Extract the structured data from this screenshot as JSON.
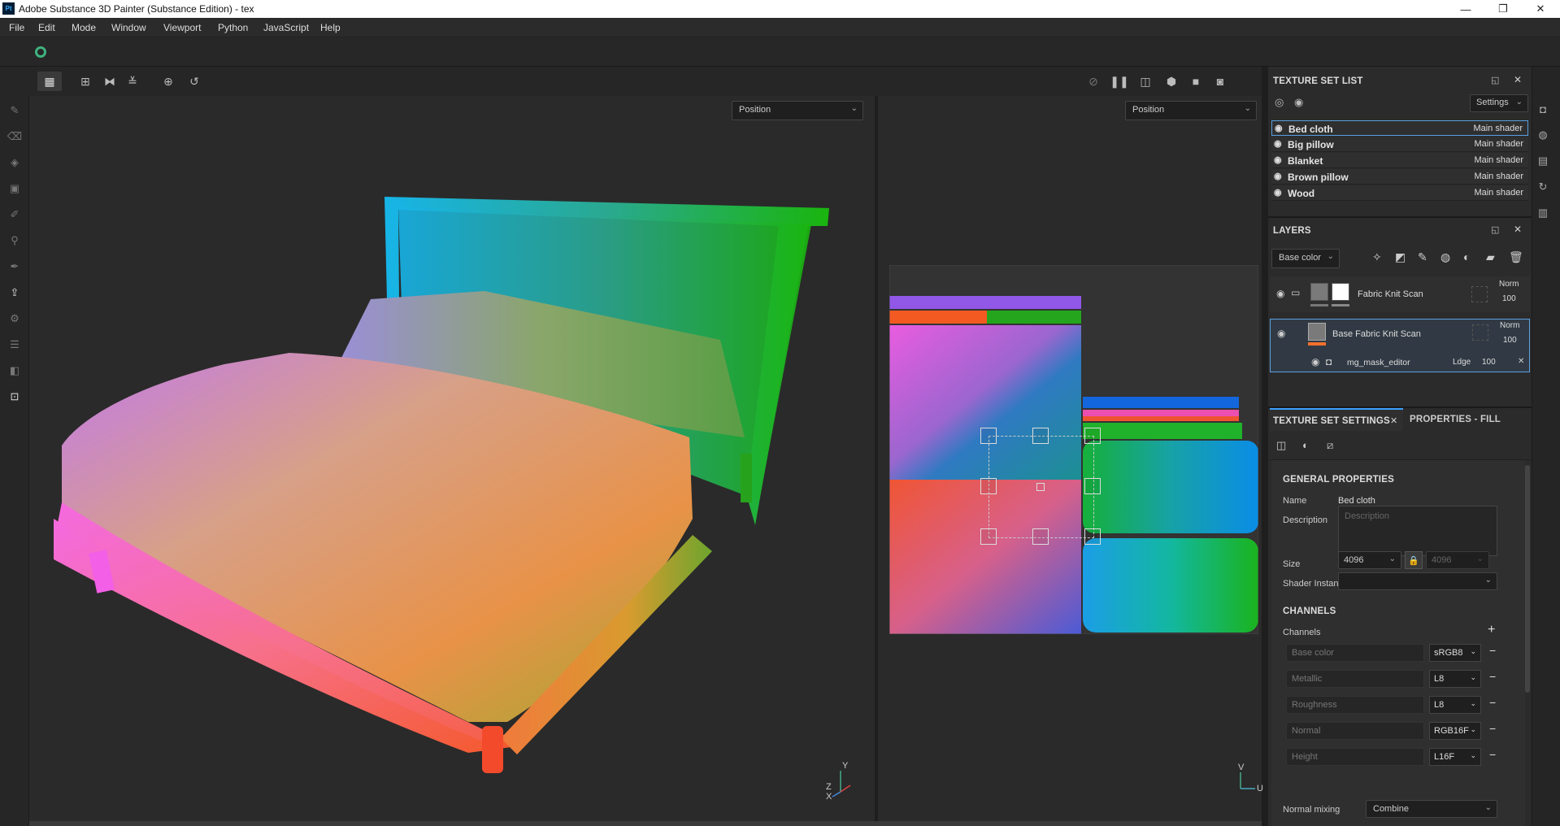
{
  "window": {
    "title": "Adobe Substance 3D Painter (Substance Edition) - tex",
    "app_icon": "Pt",
    "controls": {
      "minimize": "—",
      "maximize": "❐",
      "close": "✕"
    }
  },
  "menu": [
    "File",
    "Edit",
    "Mode",
    "Window",
    "Viewport",
    "Python",
    "JavaScript",
    "Help"
  ],
  "viewport": {
    "left_dropdown": "Position",
    "right_dropdown": "Position",
    "axis_3d": {
      "y": "Y",
      "z": "Z",
      "x": "X"
    },
    "axis_2d": {
      "v": "V",
      "u": "U"
    }
  },
  "texture_set_list": {
    "title": "TEXTURE SET LIST",
    "settings_label": "Settings",
    "items": [
      {
        "name": "Bed cloth",
        "shader": "Main shader",
        "selected": true
      },
      {
        "name": "Big pillow",
        "shader": "Main shader"
      },
      {
        "name": "Blanket",
        "shader": "Main shader"
      },
      {
        "name": "Brown pillow",
        "shader": "Main shader"
      },
      {
        "name": "Wood",
        "shader": "Main shader"
      }
    ]
  },
  "layers": {
    "title": "LAYERS",
    "channel_dropdown": "Base color",
    "items": [
      {
        "name": "Fabric Knit Scan",
        "blend": "Norm",
        "opacity": "100"
      },
      {
        "name": "Base Fabric Knit Scan",
        "blend": "Norm",
        "opacity": "100"
      }
    ],
    "mask": {
      "name": "mg_mask_editor",
      "blend": "Ldge",
      "opacity": "100"
    }
  },
  "tabs": {
    "active": "TEXTURE SET SETTINGS",
    "other": "PROPERTIES - FILL"
  },
  "general": {
    "heading": "GENERAL PROPERTIES",
    "name_label": "Name",
    "name_value": "Bed cloth",
    "description_label": "Description",
    "description_placeholder": "Description",
    "size_label": "Size",
    "size_value": "4096",
    "size_linked": "4096",
    "shader_label": "Shader Instance",
    "shader_value": ""
  },
  "channels": {
    "heading": "CHANNELS",
    "label": "Channels",
    "add": "+",
    "items": [
      {
        "name": "Base color",
        "format": "sRGB8"
      },
      {
        "name": "Metallic",
        "format": "L8"
      },
      {
        "name": "Roughness",
        "format": "L8"
      },
      {
        "name": "Normal",
        "format": "RGB16F"
      },
      {
        "name": "Height",
        "format": "L16F"
      }
    ],
    "normal_mixing_label": "Normal mixing",
    "normal_mixing_value": "Combine"
  }
}
